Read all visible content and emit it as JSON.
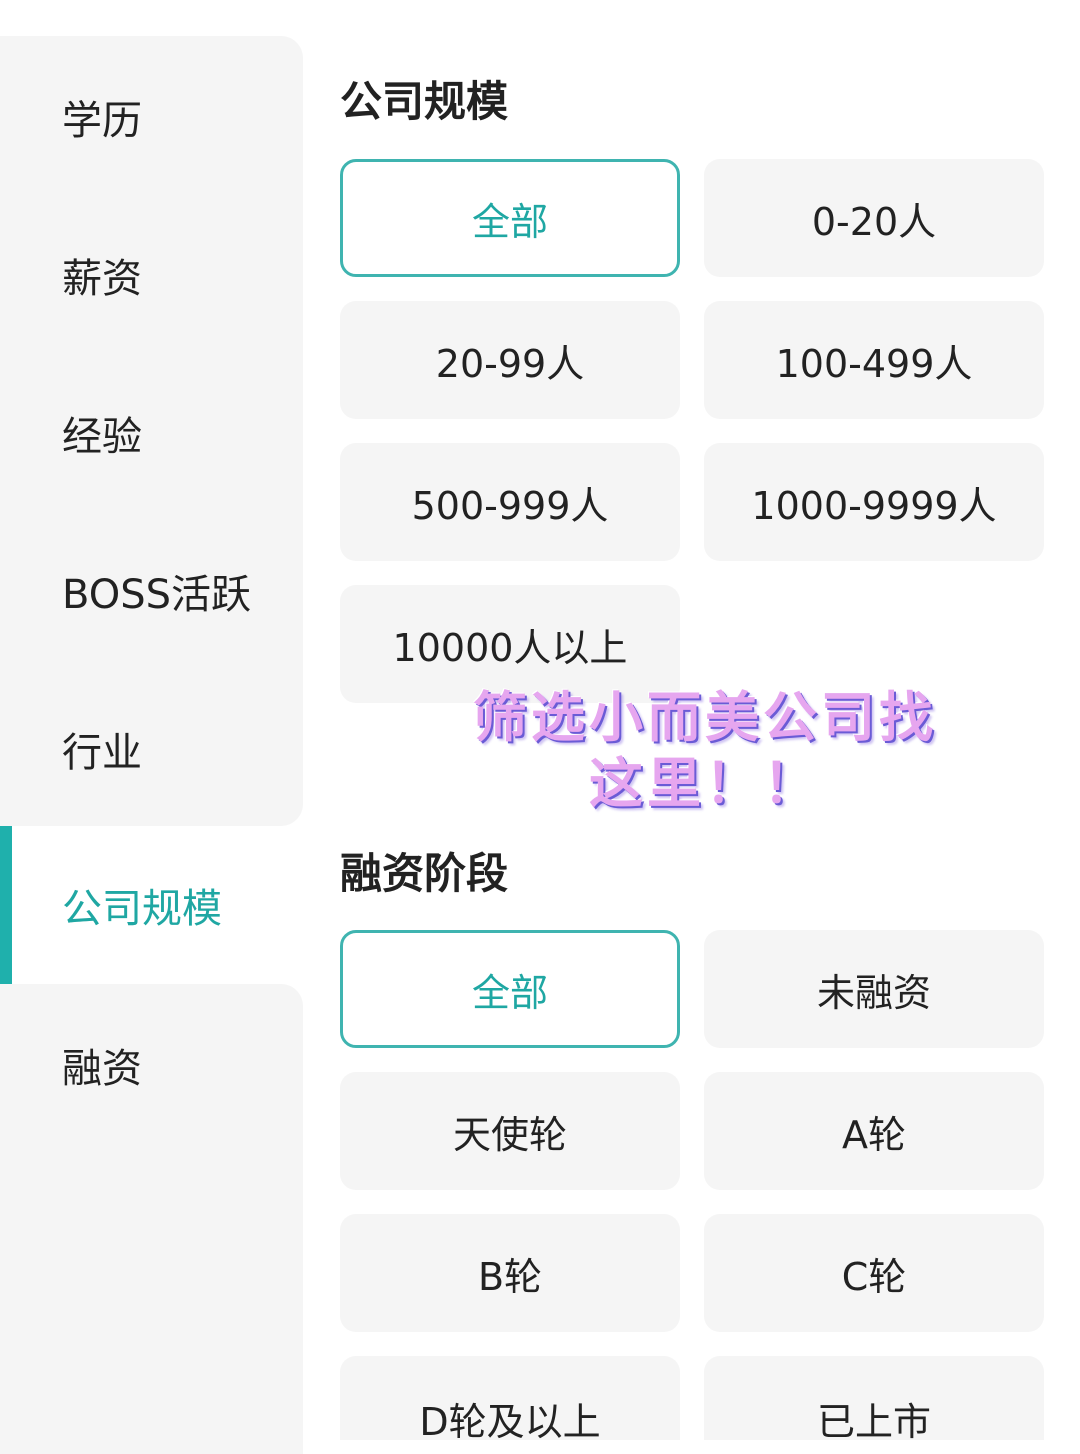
{
  "sidebar": {
    "items": [
      {
        "label": "学历"
      },
      {
        "label": "薪资"
      },
      {
        "label": "经验"
      },
      {
        "label": "BOSS活跃"
      },
      {
        "label": "行业"
      },
      {
        "label": "公司规模"
      },
      {
        "label": "融资"
      }
    ],
    "active_index": 5
  },
  "company_size": {
    "title": "公司规模",
    "options": [
      "全部",
      "0-20人",
      "20-99人",
      "100-499人",
      "500-999人",
      "1000-9999人",
      "10000人以上"
    ],
    "selected": "全部"
  },
  "financing": {
    "title": "融资阶段",
    "options": [
      "全部",
      "未融资",
      "天使轮",
      "A轮",
      "B轮",
      "C轮",
      "D轮及以上",
      "已上市"
    ],
    "selected": "全部"
  },
  "overlay": {
    "line1": "筛选小而美公司找",
    "line2": "这里！！"
  },
  "colors": {
    "accent": "#1fa7a3",
    "accent_border": "#3fb4b0",
    "chip_bg": "#f5f5f5",
    "overlay_pink": "#e6a6ef"
  }
}
